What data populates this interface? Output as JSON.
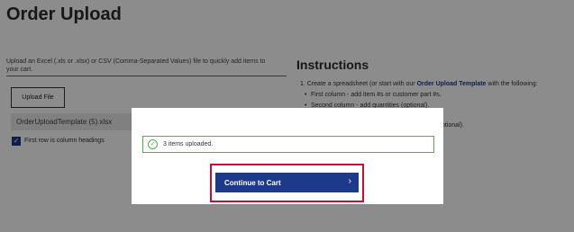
{
  "page": {
    "title": "Order Upload",
    "description": "Upload an Excel (.xls or .xlsx) or CSV (Comma-Separated Values) file to quickly add items to your cart.",
    "upload_button": "Upload File",
    "file_name": "OrderUploadTemplate (5).xlsx",
    "checkbox_label": "First row is column headings",
    "checkbox_checked": true
  },
  "instructions": {
    "title": "Instructions",
    "step1_prefix": "1. Create a spreadsheet (or start with our ",
    "step1_link": "Order Upload Template",
    "step1_suffix": " with the following:",
    "bullet1": "First column - add item #s or customer part #s.",
    "bullet2": "Second column - add quantities (optional).",
    "tail": "ptional)."
  },
  "modal": {
    "alert_icon": "check-circle-icon",
    "alert_text": "3 items uploaded.",
    "continue_button": "Continue to Cart",
    "continue_icon": "chevron-right-icon"
  },
  "colors": {
    "accent": "#1d3a8a",
    "success": "#4caf50",
    "highlight": "#c8102e"
  }
}
